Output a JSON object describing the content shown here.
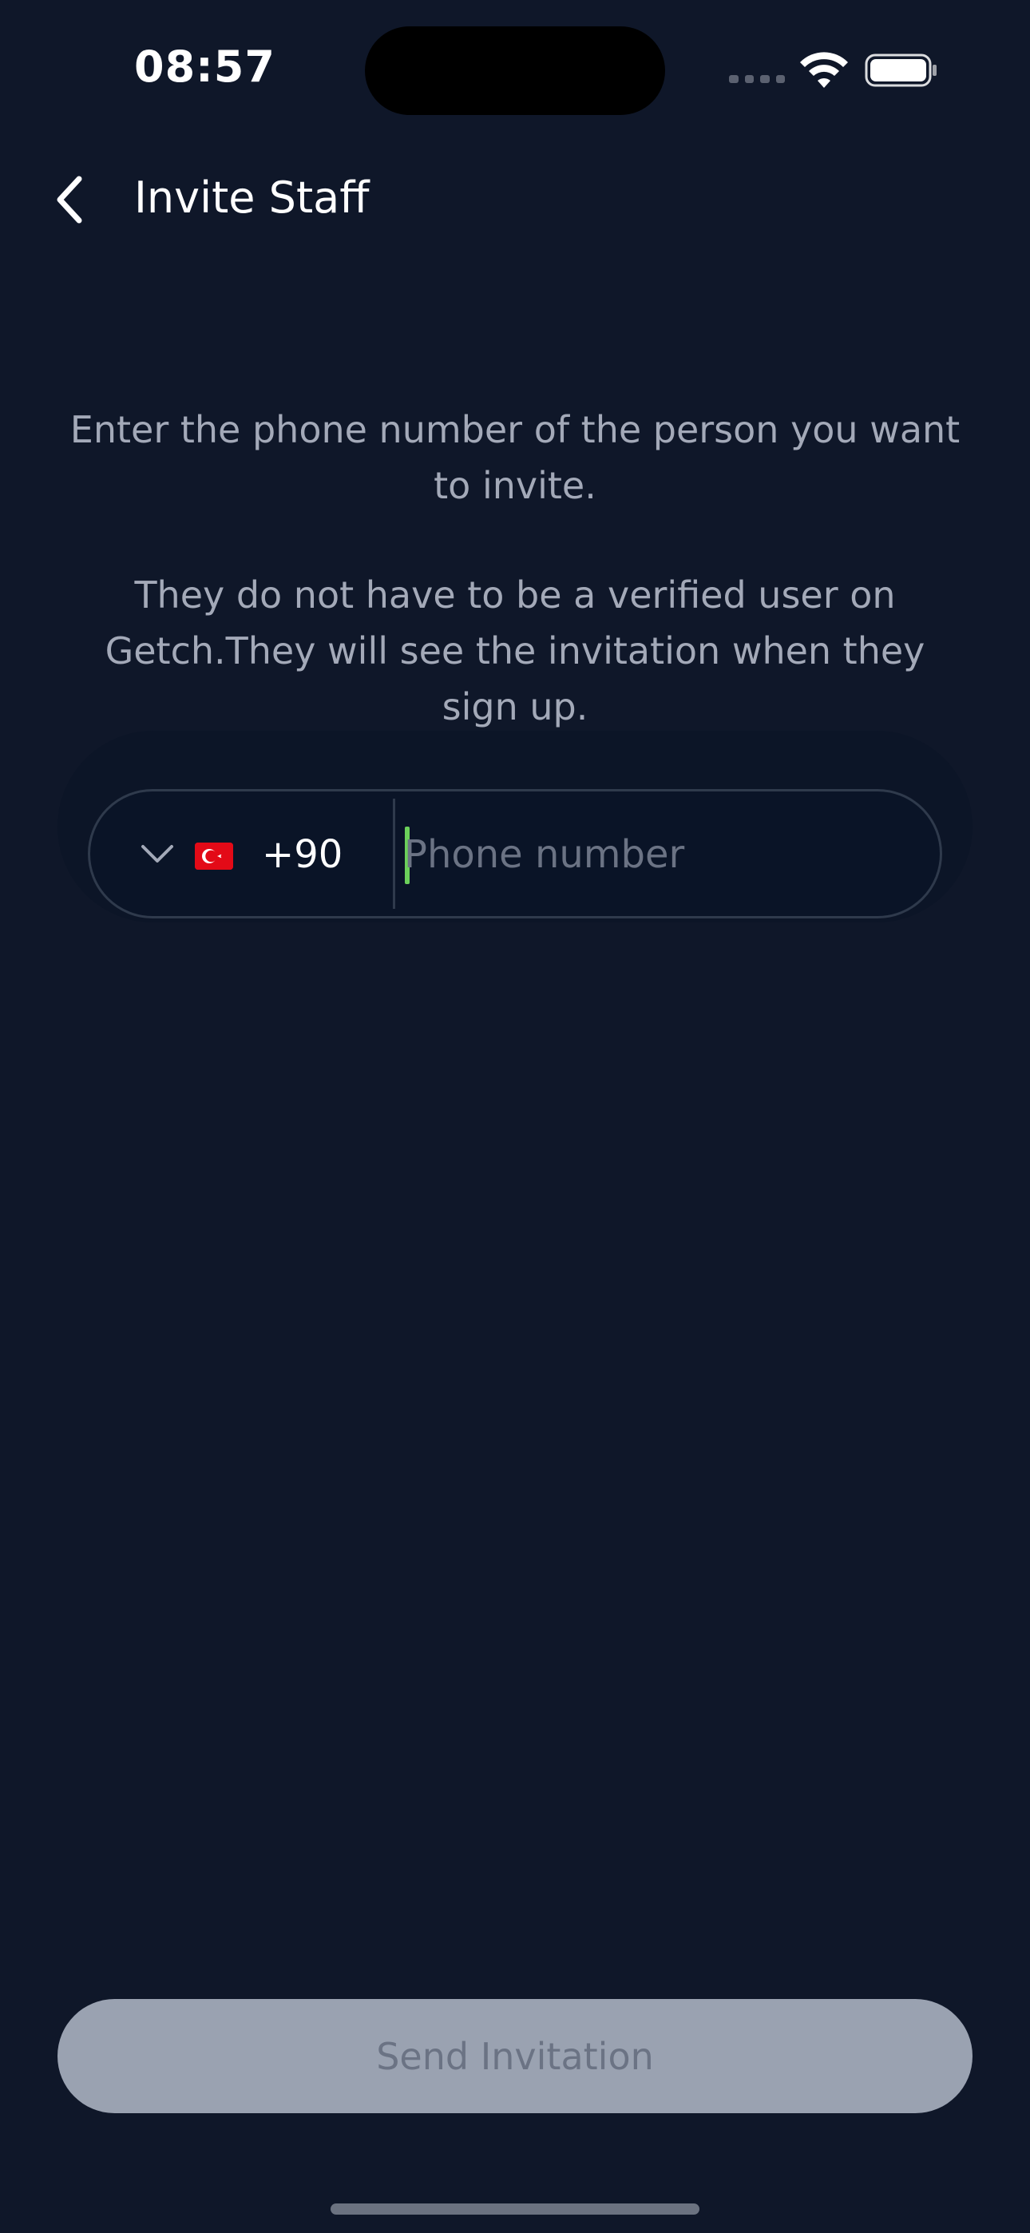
{
  "status_bar": {
    "time": "08:57",
    "icons": [
      "signal-icon",
      "wifi-icon",
      "battery-icon"
    ]
  },
  "header": {
    "back_icon": "chevron-left-icon",
    "title": "Invite Staff"
  },
  "description": {
    "line1": "Enter the phone number of the person you want to invite.",
    "line2": "They do not have to be a verified user on Getch.They will see the invitation when they sign up."
  },
  "phone": {
    "country_flag": "turkey-flag-icon",
    "country_code": "+90",
    "value": "",
    "placeholder": "Phone number"
  },
  "actions": {
    "send_label": "Send Invitation"
  },
  "colors": {
    "background": "#0f1729",
    "field_border": "#2f3a4c",
    "caret": "#6bd05a",
    "button_disabled": "#9aa2b1"
  }
}
